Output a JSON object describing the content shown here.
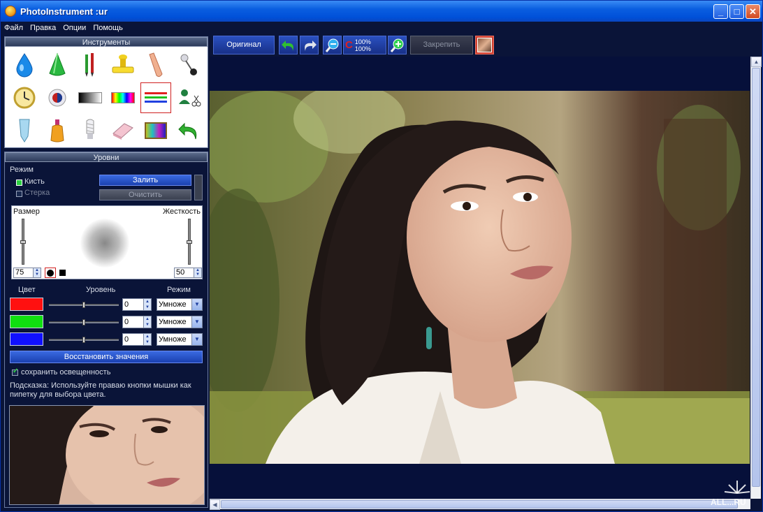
{
  "window": {
    "title": "PhotoInstrument :ur"
  },
  "menu": [
    "Файл",
    "Правка",
    "Опции",
    "Помощь"
  ],
  "tools_panel": {
    "title": "Инструменты",
    "tools": [
      "drop-icon",
      "cone-icon",
      "brushes-icon",
      "stamp-icon",
      "finger-icon",
      "pin-icon",
      "clock-icon",
      "eye-icon",
      "gradient-gray-icon",
      "spectrum-icon",
      "levels-icon",
      "clone-scissors-icon",
      "tube-icon",
      "bottle-icon",
      "bulb-icon",
      "eraser-icon",
      "tv-icon",
      "undo-arrow-icon"
    ],
    "selected": "levels-icon"
  },
  "levels_panel": {
    "title": "Уровни",
    "mode_label": "Режим",
    "brush_label": "Кисть",
    "eraser_label": "Стерка",
    "fill_label": "Залить",
    "clear_label": "Очистить",
    "size_label": "Размер",
    "hardness_label": "Жесткость",
    "size_value": "75",
    "hardness_value": "50",
    "color_header": "Цвет",
    "level_header": "Уровень",
    "mode_header": "Режим",
    "channels": [
      {
        "color": "#ff1010",
        "level": "0",
        "mode": "Умноже",
        "slider": 0.5
      },
      {
        "color": "#10e010",
        "level": "0",
        "mode": "Умноже",
        "slider": 0.5
      },
      {
        "color": "#1010ff",
        "level": "0",
        "mode": "Умноже",
        "slider": 0.5
      }
    ],
    "restore_label": "Восстановить значения",
    "preserve_label": "сохранить освещенность",
    "hint": "Подсказка: Используйте праваю кнопки мышки как пипетку для выбора цвета."
  },
  "toolbar": {
    "original_label": "Оригинал",
    "zoom_top": "100%",
    "zoom_bottom": "100%",
    "pin_label": "Закрепить"
  },
  "watermark": "ALL...RU"
}
